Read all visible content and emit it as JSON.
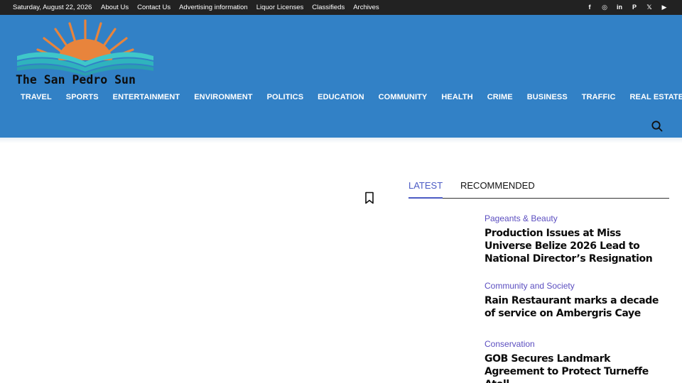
{
  "topbar": {
    "date": "Saturday, August 22, 2026",
    "links": [
      "About Us",
      "Contact Us",
      "Advertising information",
      "Liquor Licenses",
      "Classifieds",
      "Archives"
    ],
    "social": [
      {
        "name": "facebook-icon",
        "glyph": "f"
      },
      {
        "name": "instagram-icon",
        "glyph": "◎"
      },
      {
        "name": "linkedin-icon",
        "glyph": "in"
      },
      {
        "name": "pinterest-icon",
        "glyph": "P"
      },
      {
        "name": "x-icon",
        "glyph": "𝕏"
      },
      {
        "name": "youtube-icon",
        "glyph": "▶"
      }
    ]
  },
  "header": {
    "logo_text": "The San Pedro Sun",
    "nav": [
      "TRAVEL",
      "SPORTS",
      "ENTERTAINMENT",
      "ENVIRONMENT",
      "POLITICS",
      "EDUCATION",
      "COMMUNITY",
      "HEALTH",
      "CRIME",
      "BUSINESS",
      "TRAFFIC",
      "REAL ESTATE"
    ]
  },
  "colors": {
    "header_bg": "#3281c6",
    "topbar_bg": "#222222",
    "accent": "#4b5bc4",
    "sun_orange": "#e8843c",
    "wave_teal": "#3fc7c9"
  },
  "sidebar": {
    "tabs": [
      "LATEST",
      "RECOMMENDED"
    ],
    "articles": [
      {
        "category": "Pageants & Beauty",
        "title": "Production Issues at Miss Universe Belize 2026 Lead to National Director’s Resignation"
      },
      {
        "category": "Community and Society",
        "title": "Rain Restaurant marks a decade of service on Ambergris Caye"
      },
      {
        "category": "Conservation",
        "title": "GOB Secures Landmark Agreement to Protect Turneffe Atoll"
      }
    ]
  }
}
